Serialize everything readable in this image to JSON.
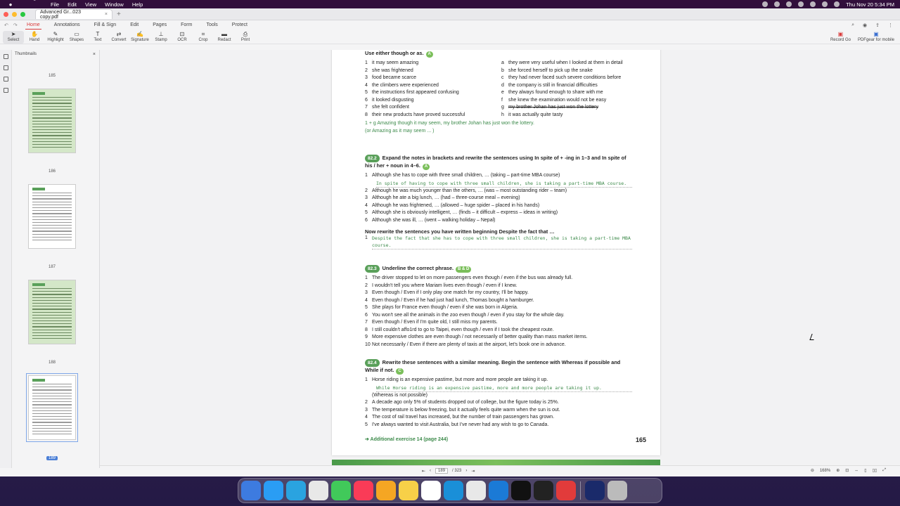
{
  "menubar": {
    "app": "PDFgear",
    "items": [
      "File",
      "Edit",
      "View",
      "Window",
      "Help"
    ],
    "clock": "Thu Nov 20  5:34 PM"
  },
  "window": {
    "tab_title": "Advanced Gr...023 copy.pdf"
  },
  "menu_tabs": [
    "Home",
    "Annotations",
    "Fill & Sign",
    "Edit",
    "Pages",
    "Form",
    "Tools",
    "Protect"
  ],
  "tools": [
    "Select",
    "Hand",
    "Highlight",
    "Shapes",
    "Text",
    "Convert",
    "Signature",
    "Stamp",
    "OCR",
    "Crop",
    "Redact",
    "Print"
  ],
  "tools_right": [
    "Record Go",
    "PDFgear for mobile"
  ],
  "sidebar": {
    "title": "Thumbnails",
    "pages": [
      "185",
      "186",
      "187",
      "188",
      "189"
    ]
  },
  "page": {
    "s1": {
      "head": "Use either though or as.",
      "level": "A",
      "left": [
        [
          "1",
          "it may seem amazing"
        ],
        [
          "2",
          "she was frightened"
        ],
        [
          "3",
          "food became scarce"
        ],
        [
          "4",
          "the climbers were experienced"
        ],
        [
          "5",
          "the instructions first appeared confusing"
        ],
        [
          "6",
          "it looked disgusting"
        ],
        [
          "7",
          "she felt confident"
        ],
        [
          "8",
          "their new products have proved successful"
        ]
      ],
      "right": [
        [
          "a",
          "they were very useful when I looked at them in detail"
        ],
        [
          "b",
          "she forced herself to pick up the snake"
        ],
        [
          "c",
          "they had never faced such severe conditions before"
        ],
        [
          "d",
          "the company is still in financial difficulties"
        ],
        [
          "e",
          "they always found enough to share with me"
        ],
        [
          "f",
          "she knew the examination would not be easy"
        ],
        [
          "g",
          "my brother Johan has just won the lottery"
        ],
        [
          "h",
          "it was actually quite tasty"
        ]
      ],
      "ans1": "1 + g   Amazing though it may seem, my brother Johan has just won the lottery.",
      "ans2": "(or   Amazing as it may seem ... )"
    },
    "s2": {
      "num": "82.2",
      "head": "Expand the notes in brackets and rewrite the sentences using In spite of + -ing in 1–3 and In spite of his / her + noun in 4–6.",
      "level": "A",
      "items": [
        [
          "1",
          "Although she has to cope with three small children, … (taking – part-time MBA course)"
        ],
        [
          "2",
          "Although he was much younger than the others, … (was – most outstanding rider – team)"
        ],
        [
          "3",
          "Although he ate a big lunch, … (had – three-course meal – evening)"
        ],
        [
          "4",
          "Although he was frightened, … (allowed – huge spider – placed in his hands)"
        ],
        [
          "5",
          "Although she is obviously intelligent, … (finds – it difficult – express – ideas in writing)"
        ],
        [
          "6",
          "Although she was ill, … (went – walking holiday – Nepal)"
        ]
      ],
      "ans": "In spite of having to cope with three small children, she is taking a part-time MBA course.",
      "now": "Now rewrite the sentences you have written beginning Despite the fact that …",
      "ans_now": "Despite the fact that she has to cope with three small children, she is taking a part-time MBA course."
    },
    "s3": {
      "num": "82.3",
      "head": "Underline the correct phrase.",
      "level": "B & D",
      "items": [
        [
          "1",
          "The driver stopped to let on more passengers even though / even if the bus was already full."
        ],
        [
          "2",
          "I wouldn't tell you where Mariam lives even though / even if I knew."
        ],
        [
          "3",
          "Even though / Even if I only play one match for my country, I'll be happy."
        ],
        [
          "4",
          "Even though / Even if he had just had lunch, Thomas bought a hamburger."
        ],
        [
          "5",
          "She plays for France even though / even if she was born in Algeria."
        ],
        [
          "6",
          "You won't see all the animals in the zoo even though / even if you stay for the whole day."
        ],
        [
          "7",
          "Even though / Even if I'm quite old, I still miss my parents."
        ],
        [
          "8",
          "I still couldn't affo1rd to go to Taipei, even though / even if I took the cheapest route."
        ],
        [
          "9",
          "More expensive clothes are even though / not necessarily of better quality than mass market items."
        ],
        [
          "10",
          "Not necessarily / Even if there are plenty of taxis at the airport, let's book one in advance."
        ]
      ]
    },
    "s4": {
      "num": "82.4",
      "head": "Rewrite these sentences with a similar meaning. Begin the sentence with Whereas if possible and While if not.",
      "level": "C",
      "items": [
        [
          "1",
          "Horse riding is an expensive pastime, but more and more people are taking it up."
        ],
        [
          "2",
          "A decade ago only 5% of students dropped out of college, but the figure today is 25%."
        ],
        [
          "3",
          "The temperature is below freezing, but it actually feels quite warm when the sun is out."
        ],
        [
          "4",
          "The cost of rail travel has increased, but the number of train passengers has grown."
        ],
        [
          "5",
          "I've always wanted to visit Australia, but I've never had any wish to go to Canada."
        ]
      ],
      "ans": "While Horse riding is an expensive pastime, more and more people are taking it up.",
      "note": "(Whereas is not possible)"
    },
    "footer_link": "➔ Additional exercise 14 (page 244)",
    "page_number": "165"
  },
  "bottom": {
    "page_current": "189",
    "page_total": "/ 323",
    "zoom": "168%"
  },
  "dock": [
    "Finder",
    "Safari",
    "Telegram",
    "Chrome",
    "Messages",
    "Music",
    "Photos",
    "Notes",
    "Calendar",
    "Scrivener",
    "Slack",
    "QB",
    "ChatGPT",
    "Terminal",
    "PDFgear",
    "Desktop",
    "Trash"
  ]
}
